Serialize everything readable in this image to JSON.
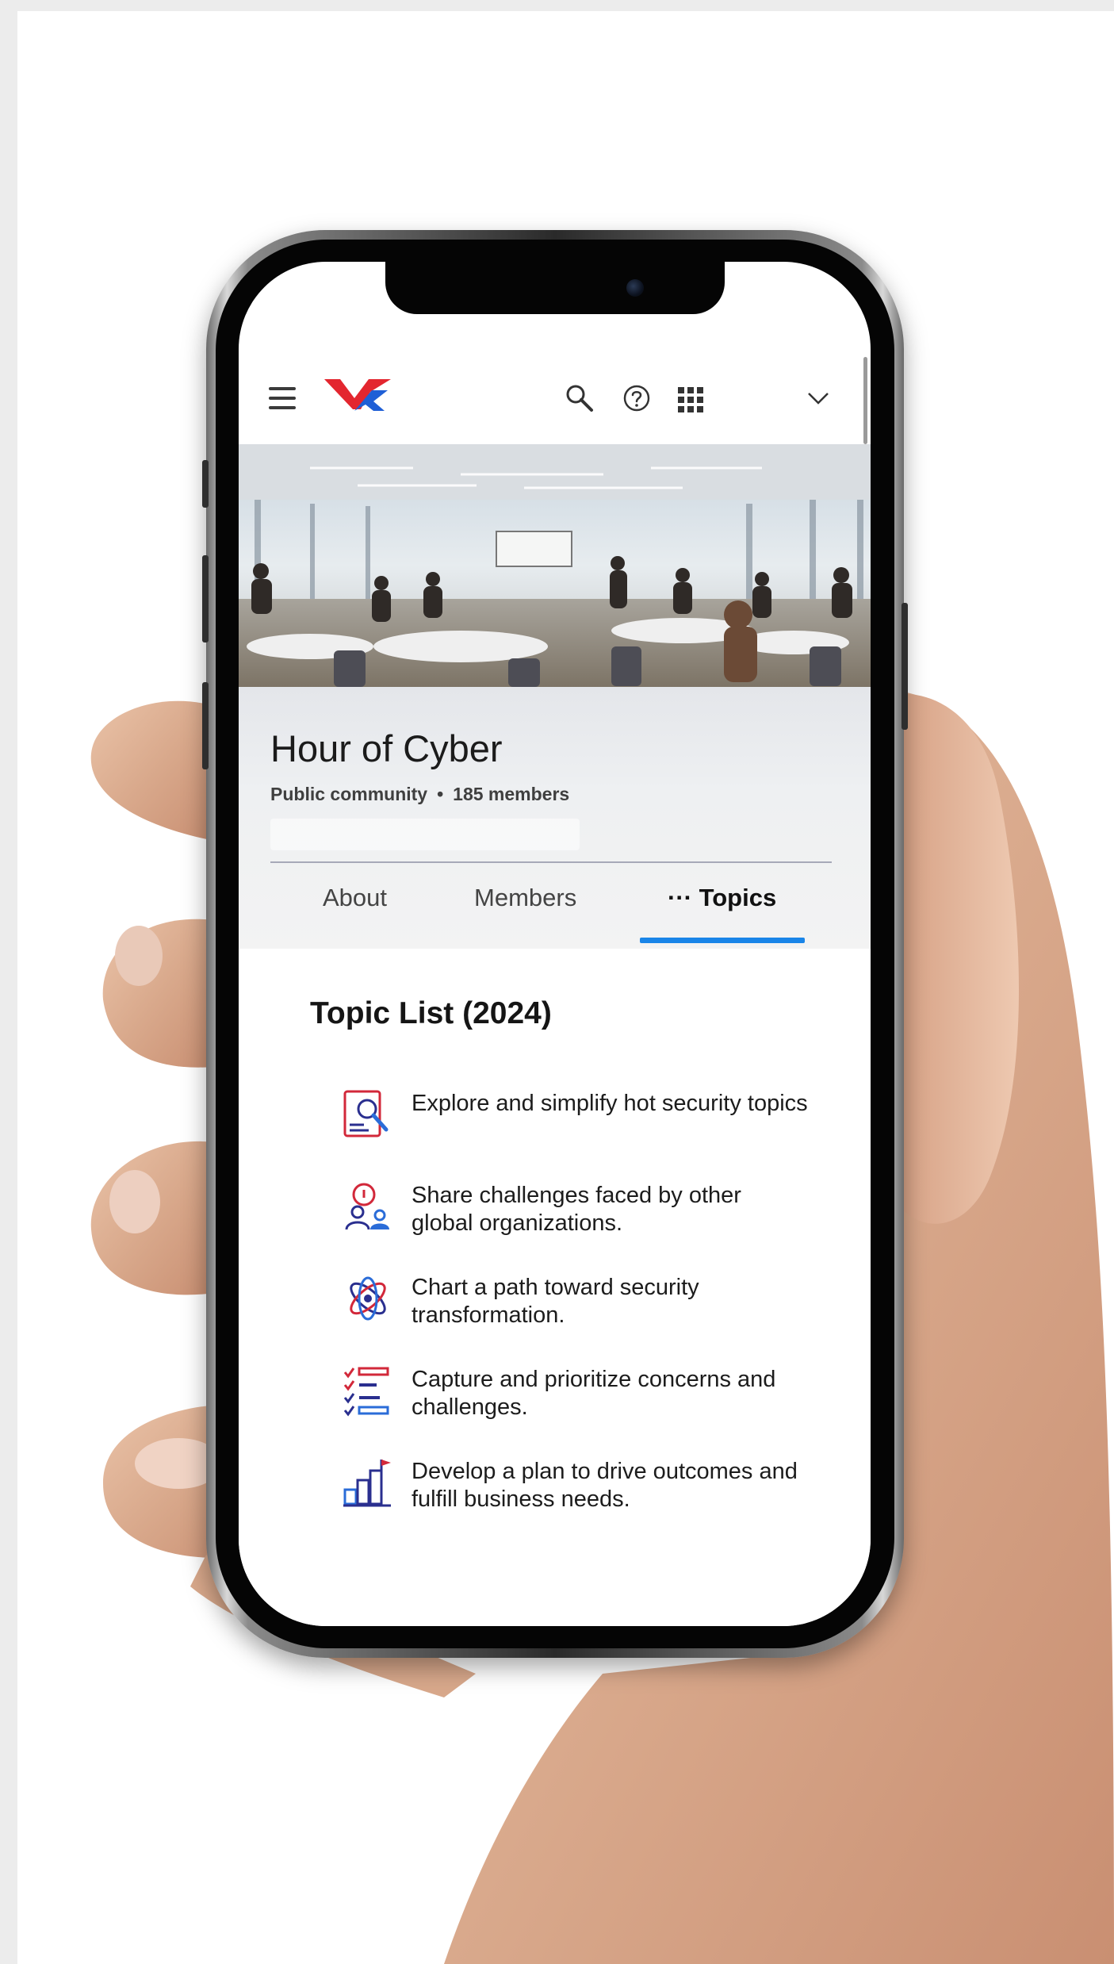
{
  "header": {
    "menu_icon": "hamburger-menu-icon",
    "logo": "brand-logo",
    "search_icon": "search-icon",
    "help_icon": "help-icon",
    "apps_icon": "apps-grid-icon",
    "expand_icon": "chevron-down-icon"
  },
  "community": {
    "title": "Hour of Cyber",
    "visibility": "Public community",
    "separator": "•",
    "members": "185 members"
  },
  "tabs": [
    {
      "label": "About",
      "active": false
    },
    {
      "label": "Members",
      "active": false
    },
    {
      "label": "··· Topics",
      "active": true
    }
  ],
  "topics": {
    "heading": "Topic List (2024)",
    "items": [
      {
        "icon": "document-search-icon",
        "text": "Explore and simplify hot security topics"
      },
      {
        "icon": "people-idea-icon",
        "text": "Share challenges faced by other global organizations."
      },
      {
        "icon": "network-atom-icon",
        "text": "Chart a path toward security transformation."
      },
      {
        "icon": "checklist-icon",
        "text": "Capture and prioritize concerns and challenges."
      },
      {
        "icon": "growth-chart-flag-icon",
        "text": "Develop a plan to drive outcomes and fulfill business needs."
      }
    ]
  },
  "colors": {
    "accent": "#1a85e8",
    "logo_red": "#e3262f",
    "logo_blue": "#1f5fd6",
    "icon_red": "#d2283a",
    "icon_navy": "#2a2f8f"
  }
}
